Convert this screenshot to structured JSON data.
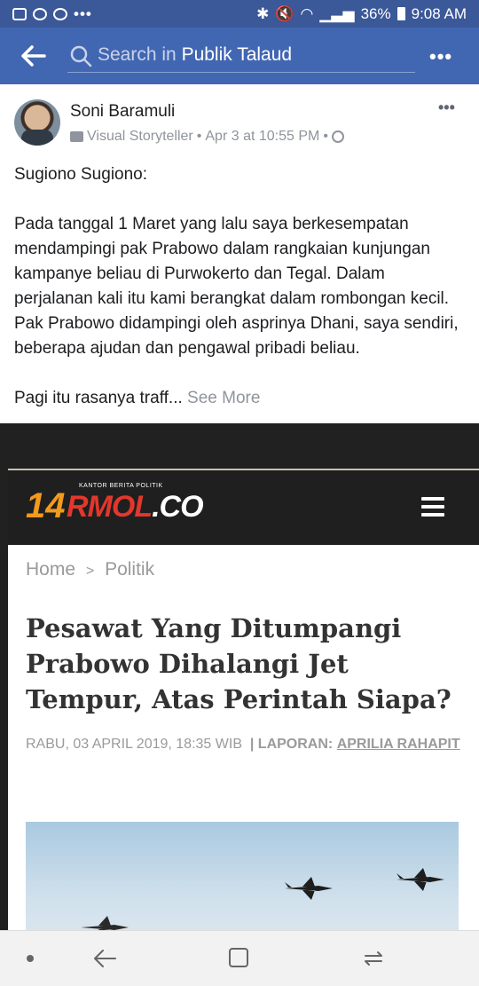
{
  "status_bar": {
    "battery": "36%",
    "time": "9:08 AM",
    "dots": "•••"
  },
  "nav": {
    "search_prefix": "Search in ",
    "search_target": "Publik Talaud",
    "more": "•••"
  },
  "post": {
    "author": "Soni Baramuli",
    "subtitle": "Visual Storyteller",
    "separator": "•",
    "timestamp": "Apr 3 at 10:55 PM",
    "more": "•••",
    "line1": "Sugiono Sugiono:",
    "paragraph": "Pada tanggal 1 Maret yang lalu saya berkesempatan mendampingi pak Prabowo dalam rangkaian kunjungan kampanye beliau di Purwokerto dan Tegal. Dalam perjalanan kali itu kami berangkat dalam rombongan kecil. Pak Prabowo didampingi oleh asprinya Dhani, saya sendiri, beberapa ajudan dan pengawal pribadi beliau.",
    "teaser": "Pagi itu rasanya traff...",
    "see_more": "See More"
  },
  "shared_article": {
    "logo_number": "14",
    "logo_text_a": "RMOL",
    "logo_text_b": ".CO",
    "logo_tagline": "KANTOR BERITA POLITIK",
    "breadcrumb_home": "Home",
    "breadcrumb_sep": ">",
    "breadcrumb_section": "Politik",
    "headline": "Pesawat Yang Ditumpangi Prabowo Dihalangi Jet Tempur, Atas Perintah Siapa?",
    "date": "RABU, 03 APRIL 2019, 18:35 WIB",
    "report_label": "| LAPORAN:",
    "reporter": "APRILIA RAHAPIT"
  }
}
